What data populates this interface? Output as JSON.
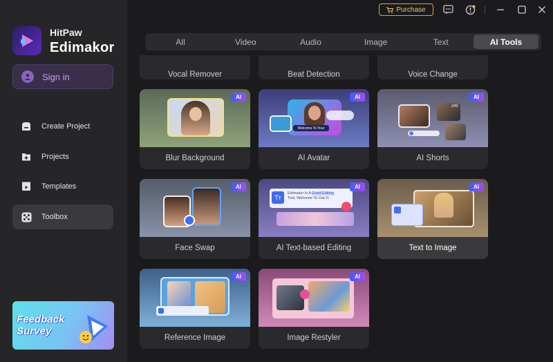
{
  "app": {
    "brand_top": "HitPaw",
    "brand_main": "Edimakor",
    "accent": "#8a5cf6"
  },
  "sidebar": {
    "signin_label": "Sign in",
    "items": [
      {
        "label": "Create Project",
        "icon": "create-project-icon"
      },
      {
        "label": "Projects",
        "icon": "folder-plus-icon"
      },
      {
        "label": "Templates",
        "icon": "templates-icon"
      },
      {
        "label": "Toolbox",
        "icon": "toolbox-icon",
        "active": true
      }
    ],
    "feedback_banner": {
      "line1": "Feedback",
      "line2": "Survey"
    }
  },
  "topbar": {
    "purchase_label": "Purchase"
  },
  "tabs": [
    {
      "label": "All"
    },
    {
      "label": "Video"
    },
    {
      "label": "Audio"
    },
    {
      "label": "Image"
    },
    {
      "label": "Text"
    },
    {
      "label": "AI Tools",
      "active": true
    }
  ],
  "partial_cards": [
    "Vocal Remover",
    "Beat Detection",
    "Voice Change"
  ],
  "cards": [
    {
      "label": "Blur Background",
      "badge": "AI"
    },
    {
      "label": "AI Avatar",
      "badge": "AI",
      "caption": "Welcome To Your"
    },
    {
      "label": "AI Shorts",
      "badge": "AI",
      "caption": "245"
    },
    {
      "label": "Face Swap",
      "badge": "AI"
    },
    {
      "label": "AI Text-based Editing",
      "badge": "AI",
      "caption_1": "Edimakor Is A",
      "caption_2": "Good Editing",
      "caption_3": "Tool, Welcome To Use It."
    },
    {
      "label": "Text to Image",
      "badge": "AI"
    },
    {
      "label": "Reference Image",
      "badge": "AI"
    },
    {
      "label": "Image Restyler",
      "badge": "AI"
    }
  ]
}
